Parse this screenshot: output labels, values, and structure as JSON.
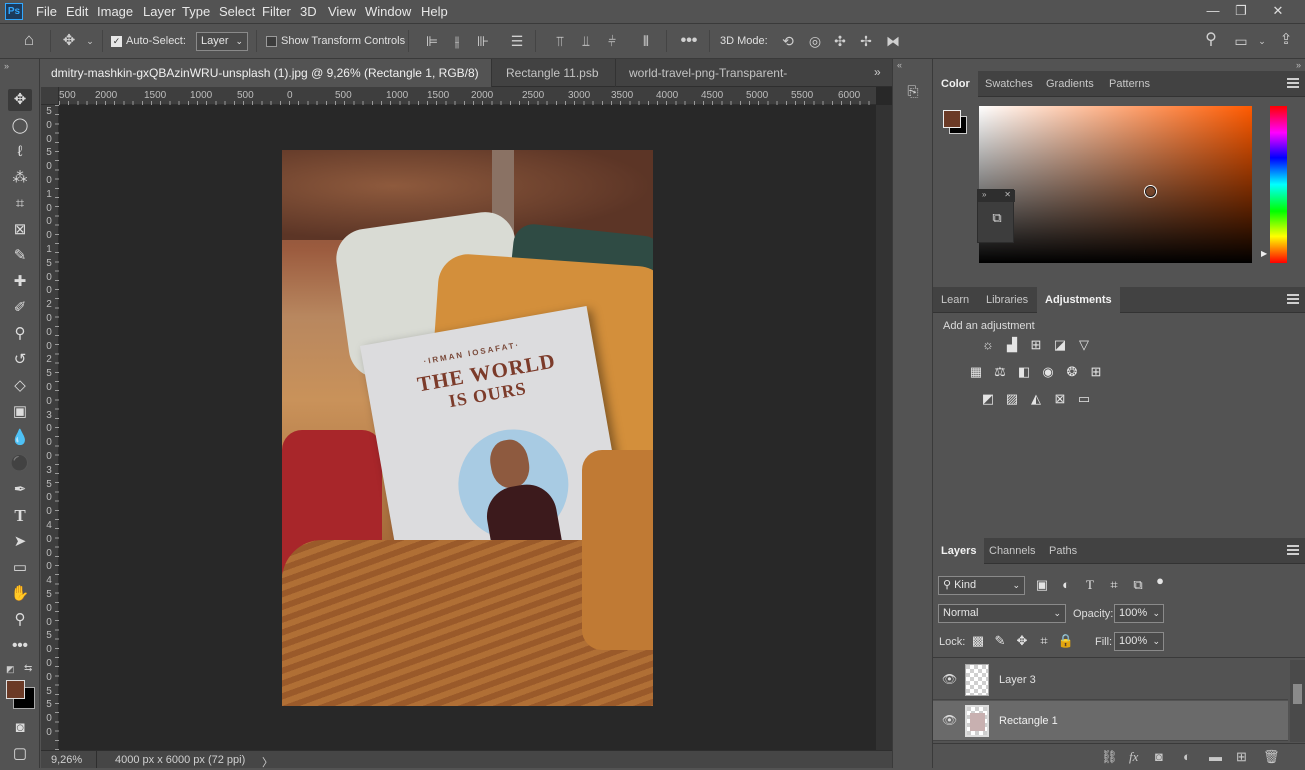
{
  "app": {
    "logo": "Ps"
  },
  "menu": [
    "File",
    "Edit",
    "Image",
    "Layer",
    "Type",
    "Select",
    "Filter",
    "3D",
    "View",
    "Window",
    "Help"
  ],
  "window_controls": {
    "minimize": "—",
    "restore": "❐",
    "close": "✕"
  },
  "options_bar": {
    "auto_select_label": "Auto-Select:",
    "auto_select_value": "Layer",
    "show_transform_label": "Show Transform Controls",
    "mode_3d_label": "3D Mode:"
  },
  "doc_tabs": [
    {
      "label": "dmitry-mashkin-gxQBAzinWRU-unsplash (1).jpg @ 9,26% (Rectangle 1, RGB/8) *",
      "close": "✕"
    },
    {
      "label": "Rectangle 11.psb",
      "close": "✕"
    },
    {
      "label": "world-travel-png-Transparent-Images.png",
      "close": ""
    }
  ],
  "ruler": {
    "h_ticks": [
      "500",
      "2000",
      "1500",
      "1000",
      "500",
      "0",
      "500",
      "1000",
      "1500",
      "2000",
      "2500",
      "3000",
      "3500",
      "4000",
      "4500",
      "5000",
      "5500",
      "6000"
    ],
    "v_ticks": [
      "5",
      "0",
      "0",
      "5",
      "0",
      "0",
      "1",
      "0",
      "0",
      "0",
      "1",
      "5",
      "0",
      "0",
      "2",
      "0",
      "0",
      "0",
      "2",
      "5",
      "0",
      "0",
      "3",
      "0",
      "0",
      "0",
      "3",
      "5",
      "0",
      "0",
      "4",
      "0",
      "0",
      "0",
      "4",
      "5",
      "0",
      "0",
      "5",
      "0",
      "0",
      "0",
      "5",
      "5",
      "0",
      "0"
    ]
  },
  "status": {
    "zoom": "9,26%",
    "doc_size": "4000 px x 6000 px (72 ppi)",
    "arrow": "〉"
  },
  "book": {
    "author": "·IRMAN IOSAFAT·",
    "title_line1": "THE WORLD",
    "title_line2": "IS OURS"
  },
  "color_panel": {
    "tabs": [
      "Color",
      "Swatches",
      "Gradients",
      "Patterns"
    ],
    "active_tab": "Color",
    "foreground": "#6b3a26",
    "background": "#000000"
  },
  "adjust_panel": {
    "tabs": [
      "Learn",
      "Libraries",
      "Adjustments"
    ],
    "active_tab": "Adjustments",
    "heading": "Add an adjustment",
    "icons_row1": [
      "brightness-icon",
      "levels-icon",
      "curves-icon",
      "exposure-icon",
      "vibrance-icon"
    ],
    "icons_row2": [
      "hue-saturation-icon",
      "color-balance-icon",
      "black-white-icon",
      "photo-filter-icon",
      "channel-mixer-icon",
      "color-lookup-icon"
    ],
    "icons_row3": [
      "invert-icon",
      "posterize-icon",
      "threshold-icon",
      "selective-color-icon",
      "gradient-map-icon"
    ]
  },
  "layers_panel": {
    "tabs": [
      "Layers",
      "Channels",
      "Paths"
    ],
    "active_tab": "Layers",
    "kind_label": "Kind",
    "blend_mode": "Normal",
    "opacity_label": "Opacity:",
    "opacity_value": "100%",
    "lock_label": "Lock:",
    "fill_label": "Fill:",
    "fill_value": "100%",
    "layers": [
      {
        "name": "Layer 3",
        "selected": false
      },
      {
        "name": "Rectangle 1",
        "selected": true
      }
    ]
  },
  "colors": {
    "accent": "#31a8ff",
    "panel_bg": "#535353",
    "canvas_bg": "#282828"
  }
}
